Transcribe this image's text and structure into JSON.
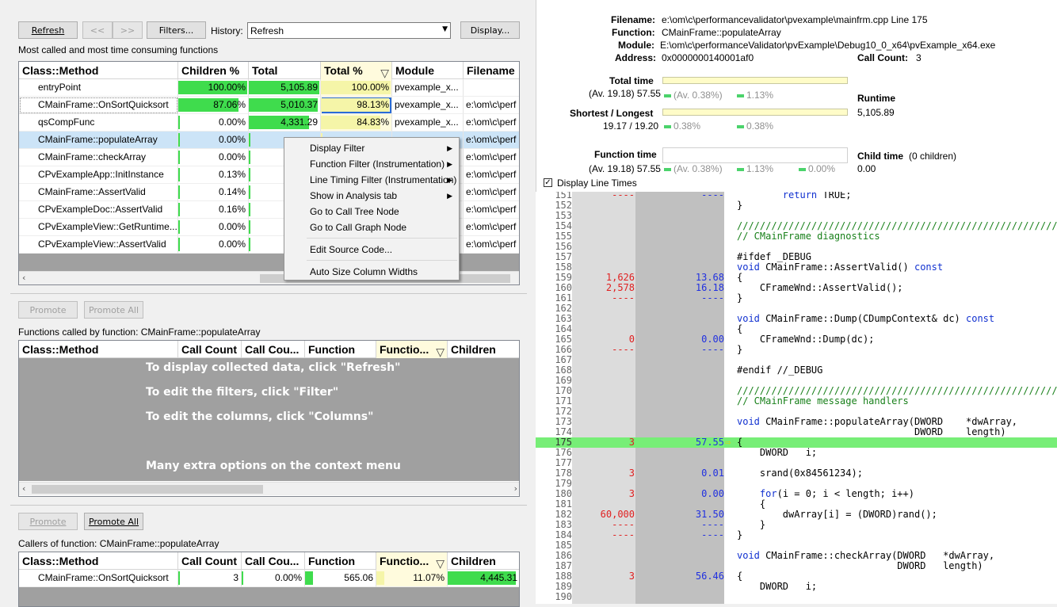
{
  "toolbar": {
    "refresh": "Refresh",
    "back": "<<",
    "forward": ">>",
    "filters": "Filters...",
    "history_label": "History:",
    "history_value": "Refresh",
    "display": "Display..."
  },
  "top_panel": {
    "label": "Most called and most time consuming functions",
    "columns": [
      "Class::Method",
      "Children %",
      "Total",
      "Total %",
      "Module",
      "Filename"
    ],
    "rows": [
      {
        "method": "entryPoint",
        "children_pct": "100.00%",
        "children_fill": 1.0,
        "total": "5,105.89",
        "total_fill": 1.0,
        "total_pct": "100.00%",
        "total_pct_fill": 1.0,
        "module": "pvexample_x...",
        "filename": ""
      },
      {
        "method": "CMainFrame::OnSortQuicksort",
        "children_pct": "87.06%",
        "children_fill": 0.8706,
        "total": "5,010.37",
        "total_fill": 0.98,
        "total_pct": "98.13%",
        "total_pct_fill": 0.9813,
        "module": "pvexample_x...",
        "filename": "e:\\om\\c\\perf"
      },
      {
        "method": "qsCompFunc",
        "children_pct": "0.00%",
        "children_fill": 0.0,
        "total": "4,331.29",
        "total_fill": 0.85,
        "total_pct": "84.83%",
        "total_pct_fill": 0.8483,
        "module": "pvexample_x...",
        "filename": "e:\\om\\c\\perf"
      },
      {
        "method": "CMainFrame::populateArray",
        "children_pct": "0.00%",
        "children_fill": 0.0,
        "total": "",
        "total_fill": 0.01,
        "total_pct": "",
        "total_pct_fill": 0.01,
        "module": "",
        "filename": "e:\\om\\c\\perf"
      },
      {
        "method": "CMainFrame::checkArray",
        "children_pct": "0.00%",
        "children_fill": 0.0,
        "total": "",
        "total_fill": 0.0,
        "total_pct": "",
        "total_pct_fill": 0.0,
        "module": "",
        "filename": "e:\\om\\c\\perf"
      },
      {
        "method": "CPvExampleApp::InitInstance",
        "children_pct": "0.13%",
        "children_fill": 0.0013,
        "total": "",
        "total_fill": 0.0,
        "total_pct": "",
        "total_pct_fill": 0.0,
        "module": "",
        "filename": "e:\\om\\c\\perf"
      },
      {
        "method": "CMainFrame::AssertValid",
        "children_pct": "0.14%",
        "children_fill": 0.0014,
        "total": "",
        "total_fill": 0.0,
        "total_pct": "",
        "total_pct_fill": 0.0,
        "module": "",
        "filename": "e:\\om\\c\\perf"
      },
      {
        "method": "CPvExampleDoc::AssertValid",
        "children_pct": "0.16%",
        "children_fill": 0.0016,
        "total": "",
        "total_fill": 0.0,
        "total_pct": "",
        "total_pct_fill": 0.0,
        "module": "",
        "filename": "e:\\om\\c\\perf"
      },
      {
        "method": "CPvExampleView::GetRuntime...",
        "children_pct": "0.00%",
        "children_fill": 0.0,
        "total": "",
        "total_fill": 0.0,
        "total_pct": "",
        "total_pct_fill": 0.0,
        "module": "",
        "filename": "e:\\om\\c\\perf"
      },
      {
        "method": "CPvExampleView::AssertValid",
        "children_pct": "0.00%",
        "children_fill": 0.0,
        "total": "",
        "total_fill": 0.0,
        "total_pct": "",
        "total_pct_fill": 0.0,
        "module": "",
        "filename": "e:\\om\\c\\perf"
      }
    ]
  },
  "context_menu": {
    "items": [
      "Display Filter",
      "Function Filter (Instrumentation)",
      "Line Timing Filter (Instrumentation)",
      "Show in Analysis tab",
      "Go to Call Tree Node",
      "Go to Call Graph Node",
      "Edit Source Code...",
      "Auto Size Column Widths"
    ]
  },
  "middle_panel": {
    "promote": "Promote",
    "promote_all": "Promote All",
    "label": "Functions called by function:  CMainFrame::populateArray",
    "columns": [
      "Class::Method",
      "Call Count",
      "Call Cou...",
      "Function",
      "Functio...",
      "Children"
    ],
    "hints": [
      "To display collected data, click \"Refresh\"",
      "To edit the filters, click \"Filter\"",
      "To edit the columns, click \"Columns\"",
      "Many extra options on the context menu"
    ]
  },
  "bottom_panel": {
    "promote": "Promote",
    "promote_all": "Promote All",
    "label": "Callers of function: CMainFrame::populateArray",
    "columns": [
      "Class::Method",
      "Call Count",
      "Call Cou...",
      "Function",
      "Functio...",
      "Children"
    ],
    "rows": [
      {
        "method": "CMainFrame::OnSortQuicksort",
        "call_count": "3",
        "call_count_pct": "0.00%",
        "function": "565.06",
        "function_pct": "11.07%",
        "children": "4,445.31"
      }
    ]
  },
  "details": {
    "filename_label": "Filename:",
    "filename": "e:\\om\\c\\performancevalidator\\pvexample\\mainfrm.cpp Line 175",
    "function_label": "Function:",
    "function": "CMainFrame::populateArray",
    "module_label": "Module:",
    "module": "E:\\om\\c\\performanceValidator\\pvExample\\Debug10_0_x64\\pvExample_x64.exe",
    "address_label": "Address:",
    "address": "0x0000000140001af0",
    "call_count_label": "Call Count:",
    "call_count": "3",
    "total_time_label": "Total time",
    "total_time_av": "(Av. 19.18) 57.55",
    "total_time_pct1": "(Av. 0.38%)",
    "total_time_pct2": "1.13%",
    "shortest_label": "Shortest / Longest",
    "shortest_val": "19.17 / 19.20",
    "shortest_pct1": "0.38%",
    "shortest_pct2": "0.38%",
    "runtime_label": "Runtime",
    "runtime": "5,105.89",
    "function_time_label": "Function time",
    "function_time_av": "(Av. 19.18) 57.55",
    "function_time_pct1": "(Av. 0.38%)",
    "function_time_pct2": "1.13%",
    "function_time_pct3": "0.00%",
    "child_time_label": "Child time",
    "child_time_note": "(0 children)",
    "child_time": "0.00",
    "display_line_times": "Display Line Times"
  },
  "source": [
    {
      "n": "151",
      "c": "----",
      "t": "----",
      "s": "        return TRUE;"
    },
    {
      "n": "152",
      "c": "",
      "t": "",
      "s": "}"
    },
    {
      "n": "153",
      "c": "",
      "t": "",
      "s": ""
    },
    {
      "n": "154",
      "c": "",
      "t": "",
      "s": "/////////////////////////////////////////////////////////////",
      "k": "cm"
    },
    {
      "n": "155",
      "c": "",
      "t": "",
      "s": "// CMainFrame diagnostics",
      "k": "cm"
    },
    {
      "n": "156",
      "c": "",
      "t": "",
      "s": ""
    },
    {
      "n": "157",
      "c": "",
      "t": "",
      "s": "#ifdef _DEBUG"
    },
    {
      "n": "158",
      "c": "",
      "t": "",
      "s": "void CMainFrame::AssertValid() const"
    },
    {
      "n": "159",
      "c": "1,626",
      "t": "13.68",
      "s": "{"
    },
    {
      "n": "160",
      "c": "2,578",
      "t": "16.18",
      "s": "    CFrameWnd::AssertValid();"
    },
    {
      "n": "161",
      "c": "----",
      "t": "----",
      "s": "}"
    },
    {
      "n": "162",
      "c": "",
      "t": "",
      "s": ""
    },
    {
      "n": "163",
      "c": "",
      "t": "",
      "s": "void CMainFrame::Dump(CDumpContext& dc) const"
    },
    {
      "n": "164",
      "c": "",
      "t": "",
      "s": "{"
    },
    {
      "n": "165",
      "c": "0",
      "t": "0.00",
      "s": "    CFrameWnd::Dump(dc);"
    },
    {
      "n": "166",
      "c": "----",
      "t": "----",
      "s": "}"
    },
    {
      "n": "167",
      "c": "",
      "t": "",
      "s": ""
    },
    {
      "n": "168",
      "c": "",
      "t": "",
      "s": "#endif //_DEBUG"
    },
    {
      "n": "169",
      "c": "",
      "t": "",
      "s": ""
    },
    {
      "n": "170",
      "c": "",
      "t": "",
      "s": "/////////////////////////////////////////////////////////////",
      "k": "cm"
    },
    {
      "n": "171",
      "c": "",
      "t": "",
      "s": "// CMainFrame message handlers",
      "k": "cm"
    },
    {
      "n": "172",
      "c": "",
      "t": "",
      "s": ""
    },
    {
      "n": "173",
      "c": "",
      "t": "",
      "s": "void CMainFrame::populateArray(DWORD    *dwArray,"
    },
    {
      "n": "174",
      "c": "",
      "t": "",
      "s": "                               DWORD    length)"
    },
    {
      "n": "175",
      "c": "3",
      "t": "57.55",
      "s": "{",
      "hl": true
    },
    {
      "n": "176",
      "c": "",
      "t": "",
      "s": "    DWORD   i;"
    },
    {
      "n": "177",
      "c": "",
      "t": "",
      "s": ""
    },
    {
      "n": "178",
      "c": "3",
      "t": "0.01",
      "s": "    srand(0x84561234);"
    },
    {
      "n": "179",
      "c": "",
      "t": "",
      "s": ""
    },
    {
      "n": "180",
      "c": "3",
      "t": "0.00",
      "s": "    for(i = 0; i < length; i++)"
    },
    {
      "n": "181",
      "c": "",
      "t": "",
      "s": "    {"
    },
    {
      "n": "182",
      "c": "60,000",
      "t": "31.50",
      "s": "        dwArray[i] = (DWORD)rand();"
    },
    {
      "n": "183",
      "c": "----",
      "t": "----",
      "s": "    }"
    },
    {
      "n": "184",
      "c": "----",
      "t": "----",
      "s": "}"
    },
    {
      "n": "185",
      "c": "",
      "t": "",
      "s": ""
    },
    {
      "n": "186",
      "c": "",
      "t": "",
      "s": "void CMainFrame::checkArray(DWORD   *dwArray,"
    },
    {
      "n": "187",
      "c": "",
      "t": "",
      "s": "                            DWORD   length)"
    },
    {
      "n": "188",
      "c": "3",
      "t": "56.46",
      "s": "{"
    },
    {
      "n": "189",
      "c": "",
      "t": "",
      "s": "    DWORD   i;"
    },
    {
      "n": "190",
      "c": "",
      "t": "",
      "s": ""
    }
  ]
}
